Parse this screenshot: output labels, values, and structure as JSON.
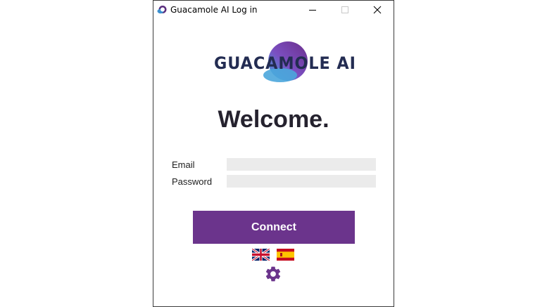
{
  "window": {
    "title": "Guacamole AI Log in"
  },
  "logo": {
    "text": "GUACAMOLE AI",
    "colors": {
      "text": "#232c52",
      "blob_purple": "#6b348c",
      "blob_blue": "#4fa3d9"
    }
  },
  "welcome": {
    "heading": "Welcome."
  },
  "form": {
    "email_label": "Email",
    "email_value": "",
    "password_label": "Password",
    "password_value": ""
  },
  "actions": {
    "connect_label": "Connect"
  },
  "languages": [
    {
      "icon": "uk-flag-icon"
    },
    {
      "icon": "spain-flag-icon"
    }
  ],
  "settings": {
    "icon": "gear-icon"
  },
  "theme": {
    "accent": "#6b348c",
    "field_bg": "#ebebeb"
  }
}
